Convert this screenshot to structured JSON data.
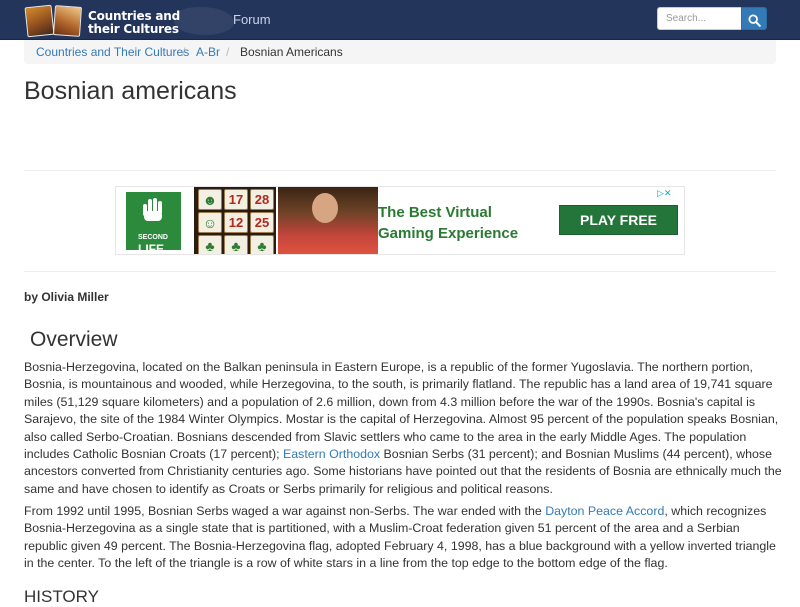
{
  "navbar": {
    "logo_line1": "Countries and",
    "logo_line2": "their Cultures",
    "forum_label": "Forum",
    "search_placeholder": "Search...",
    "search_icon": "search-icon"
  },
  "breadcrumb": {
    "items": [
      "Countries and Their Cultures",
      "A-Br",
      "Bosnian Americans"
    ],
    "separator": "/"
  },
  "page": {
    "title": "Bosnian americans",
    "author": "by Olivia Miller"
  },
  "ad": {
    "brand_small": "SECOND",
    "brand": "LIFE",
    "tiles": [
      "17",
      "28",
      "12",
      "25"
    ],
    "headline_line1": "The Best Virtual",
    "headline_line2": "Gaming Experience",
    "cta": "PLAY FREE",
    "choices_icon": "adchoices-icon"
  },
  "overview": {
    "heading": "Overview",
    "p1_a": "Bosnia-Herzegovina, located on the Balkan peninsula in Eastern Europe, is a republic of the former Yugoslavia. The northern portion, Bosnia, is mountainous and wooded, while Herzegovina, to the south, is primarily flatland. The republic has a land area of 19,741 square miles (51,129 square kilometers) and a population of 2.6 million, down from 4.3 million before the war of the 1990s. Bosnia's capital is Sarajevo, the site of the 1984 Winter Olympics. Mostar is the capital of Herzegovina. Almost 95 percent of the population speaks Bosnian, also called Serbo-Croatian. Bosnians descended from Slavic settlers who came to the area in the early Middle Ages. The population includes Catholic Bosnian Croats (17 percent); ",
    "p1_link": "Eastern Orthodox",
    "p1_b": " Bosnian Serbs (31 percent); and Bosnian Muslims (44 percent), whose ancestors converted from Christianity centuries ago. Some historians have pointed out that the residents of Bosnia are ethnically much the same and have chosen to identify as Croats or Serbs primarily for religious and political reasons.",
    "p2_a": "From 1992 until 1995, Bosnian Serbs waged a war against non-Serbs. The war ended with the ",
    "p2_link": "Dayton Peace Accord",
    "p2_b": ", which recognizes Bosnia-Herzegovina as a single state that is partitioned, with a Muslim-Croat federation given 51 percent of the area and a Serbian republic given 49 percent. The Bosnia-Herzegovina flag, adopted February 4, 1998, has a blue background with a yellow inverted triangle in the center. To the left of the triangle is a row of white stars in a line from the top edge to the bottom edge of the flag."
  },
  "history": {
    "heading": "HISTORY"
  },
  "colors": {
    "navbar_bg": "#24355c",
    "link": "#337ab7",
    "ad_green": "#23753a"
  }
}
